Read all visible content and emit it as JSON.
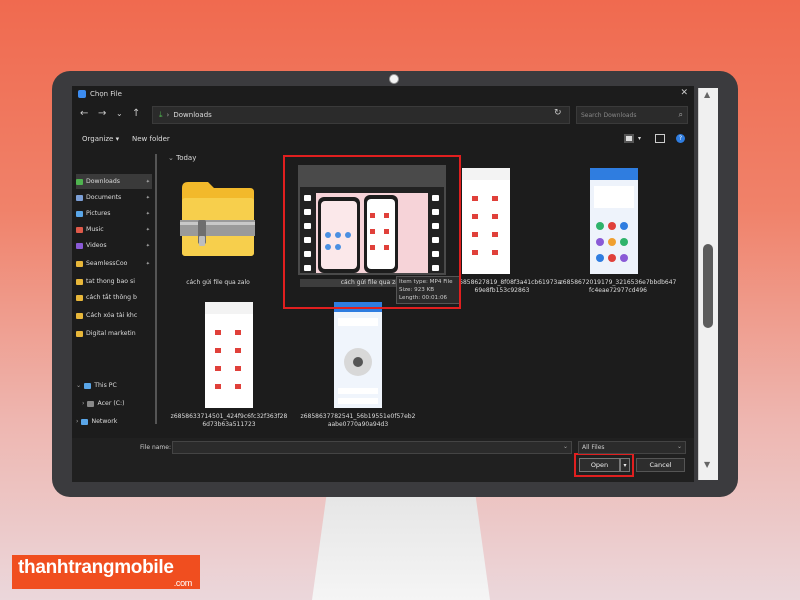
{
  "window": {
    "title": "Chọn File"
  },
  "address": {
    "path": "Downloads",
    "search_placeholder": "Search Downloads"
  },
  "toolbar": {
    "organize": "Organize ▾",
    "new_folder": "New folder"
  },
  "sidebar": {
    "items": [
      {
        "label": "Downloads",
        "icon": "download-icon",
        "color": "#4fb34f",
        "pinned": true
      },
      {
        "label": "Documents",
        "icon": "document-icon",
        "color": "#7c9fd6",
        "pinned": true
      },
      {
        "label": "Pictures",
        "icon": "picture-icon",
        "color": "#5aa6e8",
        "pinned": true
      },
      {
        "label": "Music",
        "icon": "music-icon",
        "color": "#e05a4a",
        "pinned": true
      },
      {
        "label": "Videos",
        "icon": "video-icon",
        "color": "#8a5ad6",
        "pinned": true
      },
      {
        "label": "SeamlessCoo",
        "icon": "folder-icon",
        "color": "#e8b73a",
        "pinned": true
      },
      {
        "label": "tat thong bao si",
        "icon": "folder-icon",
        "color": "#e8b73a",
        "pinned": false
      },
      {
        "label": "cách tắt thông b",
        "icon": "folder-icon",
        "color": "#e8b73a",
        "pinned": false
      },
      {
        "label": "Cách xóa tài khc",
        "icon": "folder-icon",
        "color": "#e8b73a",
        "pinned": false
      },
      {
        "label": "Digital marketin",
        "icon": "folder-icon",
        "color": "#e8b73a",
        "pinned": false
      }
    ],
    "this_pc": "This PC",
    "drive": "Acer (C:)",
    "network": "Network"
  },
  "content": {
    "group": "Today",
    "tiles": [
      {
        "label": "cách gửi file qua zalo"
      },
      {
        "label": "cách gửi file qua zalo"
      },
      {
        "label": "z6858627819_8f08f3a41cb61973a\n69e8fb153c92863"
      },
      {
        "label": "z6858672019179_3216536e7bbdb647\nfc4eae72977cd496"
      },
      {
        "label": "z6858633714501_424f9c6fc32f363f28\n6d73b63a511723"
      },
      {
        "label": "z6858637782541_56b19551e0f57eb2\naabe0770a90a94d3"
      }
    ],
    "tooltip": {
      "type": "Item type: MP4 File",
      "size": "Size: 923 KB",
      "length": "Length: 00:01:06"
    }
  },
  "bottom": {
    "file_name_label": "File name:",
    "file_type": "All Files",
    "open": "Open",
    "open_dropdown": "▾",
    "cancel": "Cancel"
  },
  "brand": {
    "name": "thanhtrangmobile",
    "suffix": ".com",
    "color": "#f04e1f"
  }
}
